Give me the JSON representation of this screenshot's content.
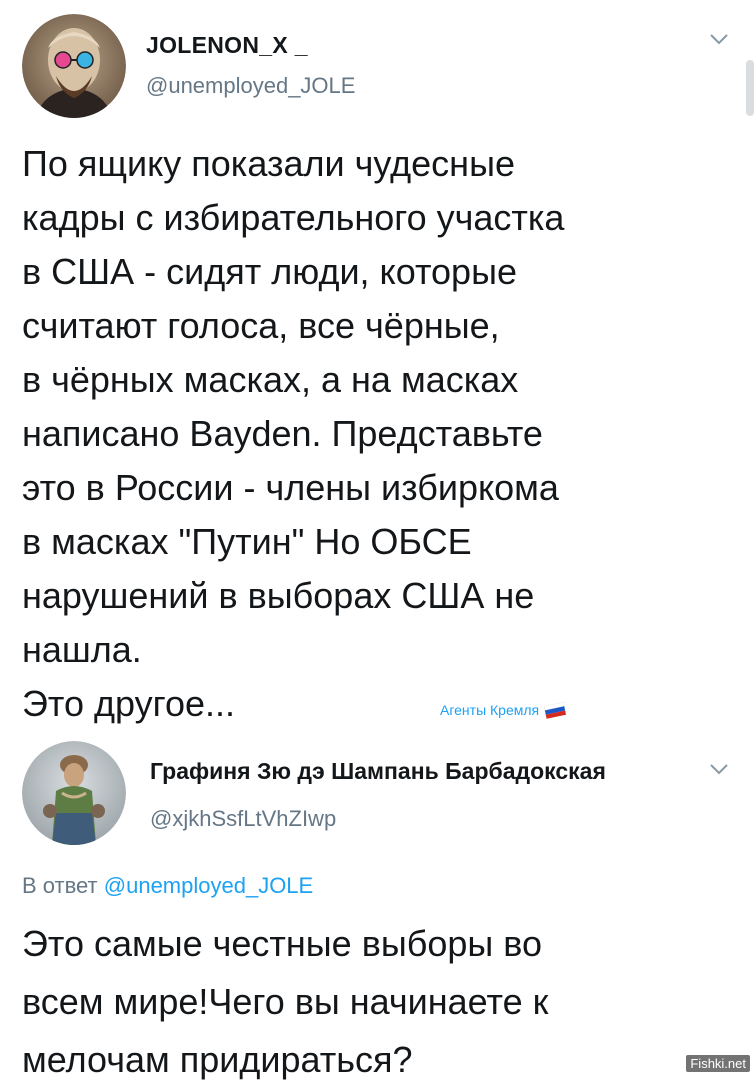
{
  "tweet1": {
    "display_name": "JOLENON_X _",
    "handle": "@unemployed_JOLE",
    "text_main": "По ящику показали чудесные\nкадры с избирательного участка\nв США - сидят люди, которые\nсчитают голоса, все чёрные,\nв чёрных масках, а на масках\nнаписано Bayden. Представьте\nэто в России - члены избиркома\nв масках \"Путин\" Но ОБСЕ\nнарушений в выборах США не\nнашла.",
    "text_last": "Это другое...",
    "avatar_icon": "avatar-lenin-glasses-icon",
    "menu_icon": "chevron-down-icon"
  },
  "watermark": {
    "text": "Агенты Кремля",
    "icon": "russian-flag-icon"
  },
  "tweet2": {
    "display_name": "Графиня Зю дэ Шампань Барбадокская",
    "handle": "@xjkhSsfLtVhZIwp",
    "reply_prefix": "В ответ",
    "reply_handle": "@unemployed_JOLE",
    "text": "Это самые честные выборы во\nвсем мире!Чего вы начинаете к\nмелочам придираться?",
    "avatar_icon": "avatar-countess-icon",
    "menu_icon": "chevron-down-icon"
  },
  "site_watermark": "Fishki.net",
  "colors": {
    "text": "#14171a",
    "secondary": "#657786",
    "link": "#1da1f2",
    "background": "#ffffff"
  }
}
